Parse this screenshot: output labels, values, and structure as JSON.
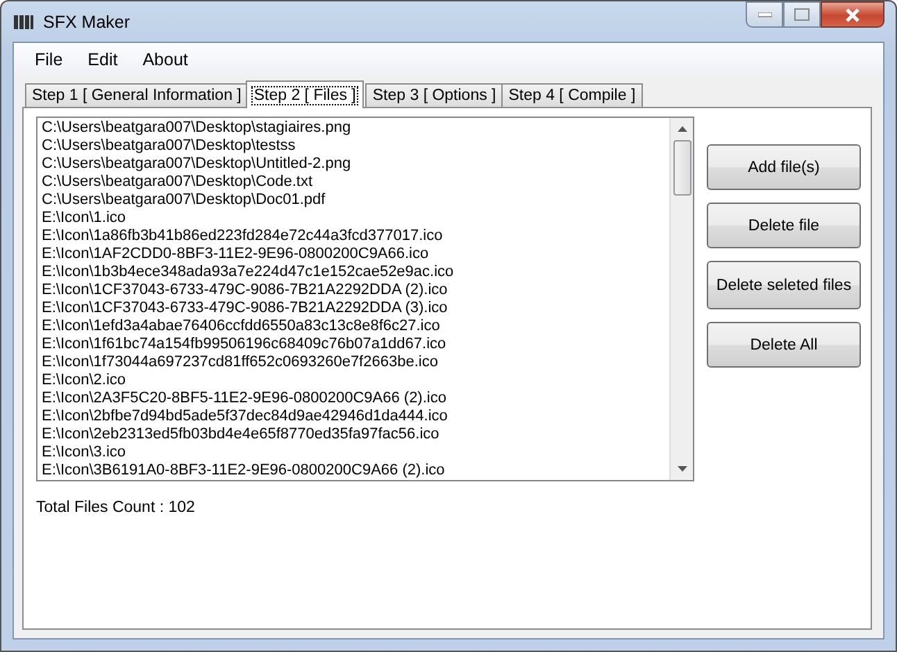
{
  "window": {
    "title": "SFX Maker"
  },
  "menu": [
    "File",
    "Edit",
    "About"
  ],
  "tabs": [
    {
      "label": "Step 1 [ General Information ]",
      "selected": false
    },
    {
      "label": "Step 2 [ Files ]",
      "selected": true
    },
    {
      "label": "Step 3 [ Options ]",
      "selected": false
    },
    {
      "label": "Step 4 [ Compile ]",
      "selected": false
    }
  ],
  "files": [
    "C:\\Users\\beatgara007\\Desktop\\stagiaires.png",
    "C:\\Users\\beatgara007\\Desktop\\testss",
    "C:\\Users\\beatgara007\\Desktop\\Untitled-2.png",
    "C:\\Users\\beatgara007\\Desktop\\Code.txt",
    "C:\\Users\\beatgara007\\Desktop\\Doc01.pdf",
    "E:\\Icon\\1.ico",
    "E:\\Icon\\1a86fb3b41b86ed223fd284e72c44a3fcd377017.ico",
    "E:\\Icon\\1AF2CDD0-8BF3-11E2-9E96-0800200C9A66.ico",
    "E:\\Icon\\1b3b4ece348ada93a7e224d47c1e152cae52e9ac.ico",
    "E:\\Icon\\1CF37043-6733-479C-9086-7B21A2292DDA (2).ico",
    "E:\\Icon\\1CF37043-6733-479C-9086-7B21A2292DDA (3).ico",
    "E:\\Icon\\1efd3a4abae76406ccfdd6550a83c13c8e8f6c27.ico",
    "E:\\Icon\\1f61bc74a154fb99506196c68409c76b07a1dd67.ico",
    "E:\\Icon\\1f73044a697237cd81ff652c0693260e7f2663be.ico",
    "E:\\Icon\\2.ico",
    "E:\\Icon\\2A3F5C20-8BF5-11E2-9E96-0800200C9A66 (2).ico",
    "E:\\Icon\\2bfbe7d94bd5ade5f37dec84d9ae42946d1da444.ico",
    "E:\\Icon\\2eb2313ed5fb03bd4e4e65f8770ed35fa97fac56.ico",
    "E:\\Icon\\3.ico",
    "E:\\Icon\\3B6191A0-8BF3-11E2-9E96-0800200C9A66 (2).ico"
  ],
  "buttons": [
    "Add file(s)",
    "Delete file",
    "Delete seleted files",
    "Delete All"
  ],
  "status": "Total Files Count : 102"
}
